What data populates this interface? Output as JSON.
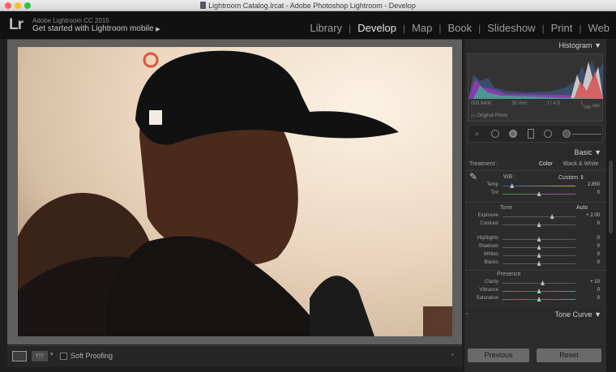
{
  "titlebar": {
    "title": "Lightroom Catalog.lrcat - Adobe Photoshop Lightroom - Develop"
  },
  "identity": {
    "logo": "Lr",
    "version": "Adobe Lightroom CC 2015",
    "mobile": "Get started with Lightroom mobile",
    "mobile_arrow": "▶"
  },
  "modules": [
    "Library",
    "Develop",
    "Map",
    "Book",
    "Slideshow",
    "Print",
    "Web"
  ],
  "active_module": "Develop",
  "histogram": {
    "title": "Histogram",
    "iso": "ISO 6400",
    "focal": "50 mm",
    "aperture": "f / 4.0",
    "shutter_num": "1",
    "shutter_den": "160",
    "shutter_unit": "sec",
    "original": "Original Photo"
  },
  "basic": {
    "title": "Basic",
    "treatment_label": "Treatment :",
    "color": "Color",
    "bw": "Black & White",
    "wb_label": "WB :",
    "wb_value": "Custom",
    "wb_arrow": "⇕",
    "tone_title": "Tone",
    "auto": "Auto",
    "presence_title": "Presence",
    "sliders": {
      "temp": {
        "label": "Temp",
        "value": "2,850",
        "pos": 0.13
      },
      "tint": {
        "label": "Tint",
        "value": "0",
        "pos": 0.5
      },
      "exposure": {
        "label": "Exposure",
        "value": "+ 2.00",
        "pos": 0.68
      },
      "contrast": {
        "label": "Contrast",
        "value": "0",
        "pos": 0.5
      },
      "highlights": {
        "label": "Highlights",
        "value": "0",
        "pos": 0.5
      },
      "shadows": {
        "label": "Shadows",
        "value": "0",
        "pos": 0.5
      },
      "whites": {
        "label": "Whites",
        "value": "0",
        "pos": 0.5
      },
      "blacks": {
        "label": "Blacks",
        "value": "0",
        "pos": 0.5
      },
      "clarity": {
        "label": "Clarity",
        "value": "+ 10",
        "pos": 0.55
      },
      "vibrance": {
        "label": "Vibrance",
        "value": "0",
        "pos": 0.5
      },
      "saturation": {
        "label": "Saturation",
        "value": "0",
        "pos": 0.5
      }
    }
  },
  "tone_curve": {
    "title": "Tone Curve"
  },
  "toolbar": {
    "soft_proofing": "Soft Proofing",
    "view_yy": "Y|Y"
  },
  "buttons": {
    "previous": "Previous",
    "reset": "Reset"
  },
  "colors": {
    "panel": "#2c2c2c",
    "accent": "#e6e6e6"
  }
}
